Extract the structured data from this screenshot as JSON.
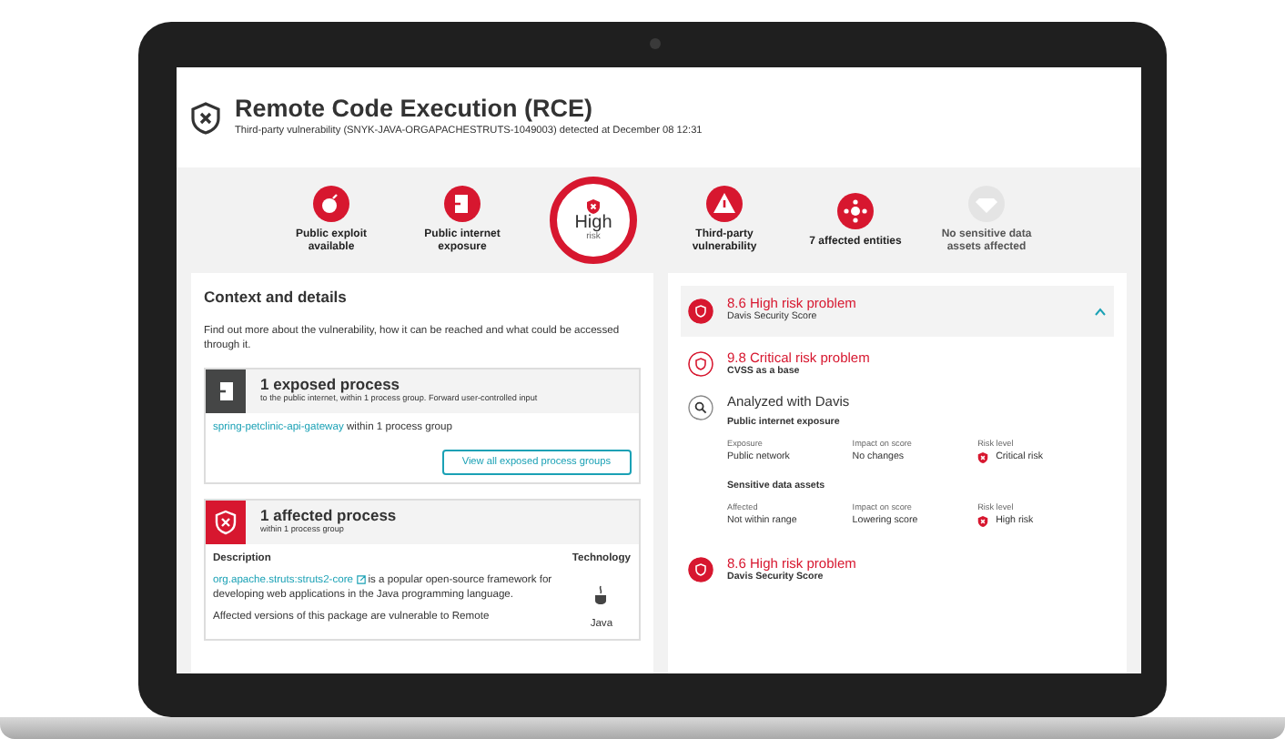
{
  "header": {
    "title": "Remote Code Execution (RCE)",
    "subtitle": "Third-party vulnerability (SNYK-JAVA-ORGAPACHESTRUTS-1049003) detected at December 08 12:31"
  },
  "risk_factors": [
    {
      "kind": "exploit",
      "label": "Public exploit available",
      "active": true
    },
    {
      "kind": "exposure",
      "label": "Public internet exposure",
      "active": true
    },
    {
      "kind": "score",
      "value": "High",
      "caption": "risk"
    },
    {
      "kind": "dependency",
      "label": "Third-party vulnerability",
      "active": true
    },
    {
      "kind": "entities",
      "label": "7 affected entities",
      "active": true
    },
    {
      "kind": "assets",
      "label": "No sensitive data assets affected",
      "active": false
    }
  ],
  "context": {
    "title": "Context and details",
    "intro": "Find out more about the vulnerability, how it can be reached and what could be accessed through it.",
    "exposed": {
      "title": "1 exposed process",
      "subtitle": "to the public internet, within 1 process group. Forward user-controlled input",
      "link": "spring-petclinic-api-gateway",
      "link_suffix": " within 1 process group",
      "button": "View all exposed process groups"
    },
    "affected": {
      "title": "1 affected process",
      "subtitle": "within 1 process group",
      "col_description": "Description",
      "col_technology": "Technology",
      "package_link": "org.apache.struts:struts2-core",
      "description": " is a popular open-source framework for developing web applications in the Java programming language.",
      "technology": "Java",
      "more": "Affected versions of this package are vulnerable to Remote"
    }
  },
  "score_panel": {
    "score": "8.6 High risk problem",
    "label": "Davis Security Score",
    "expanded": true,
    "steps": [
      {
        "kind": "score",
        "title": "9.8 Critical risk problem",
        "subtitle": "CVSS as a base",
        "filled": false
      },
      {
        "kind": "analysis",
        "title": "Analyzed with Davis",
        "sections": [
          {
            "title": "Public internet exposure",
            "cells": [
              {
                "kind": "text",
                "label": "Exposure",
                "value": "Public network"
              },
              {
                "kind": "text",
                "label": "Impact on score",
                "value": "No changes"
              },
              {
                "kind": "risk",
                "label": "Risk level",
                "value": "Critical risk"
              }
            ]
          },
          {
            "title": "Sensitive data assets",
            "cells": [
              {
                "kind": "text",
                "label": "Affected",
                "value": "Not within range"
              },
              {
                "kind": "text",
                "label": "Impact on score",
                "value": "Lowering score"
              },
              {
                "kind": "risk",
                "label": "Risk level",
                "value": "High risk"
              }
            ]
          }
        ]
      },
      {
        "kind": "score",
        "title": "8.6 High risk problem",
        "subtitle": "Davis Security Score",
        "filled": true
      }
    ]
  }
}
